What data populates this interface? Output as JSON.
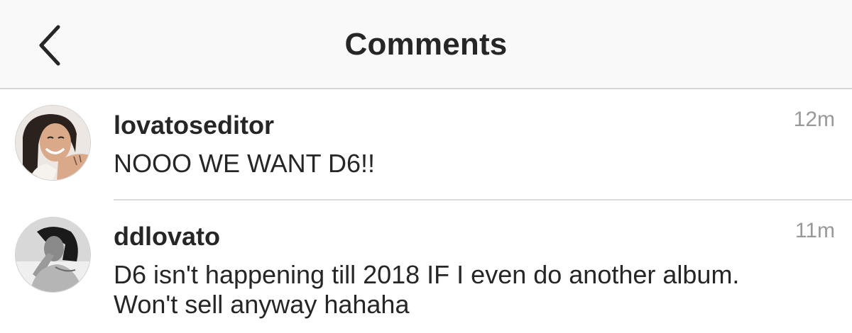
{
  "header": {
    "title": "Comments",
    "back_icon": "chevron-left-icon"
  },
  "comments": [
    {
      "username": "lovatoseditor",
      "text": "NOOO WE WANT D6!!",
      "time": "12m",
      "avatar": "avatar-photo"
    },
    {
      "username": "ddlovato",
      "text": "D6 isn't happening till 2018 IF I even do another album. Won't sell anyway hahaha",
      "time": "11m",
      "avatar": "avatar-photo"
    }
  ],
  "colors": {
    "nav_background": "#f9f9f9",
    "text": "#262626",
    "timestamp": "#999999",
    "divider": "#dcdcdc"
  }
}
